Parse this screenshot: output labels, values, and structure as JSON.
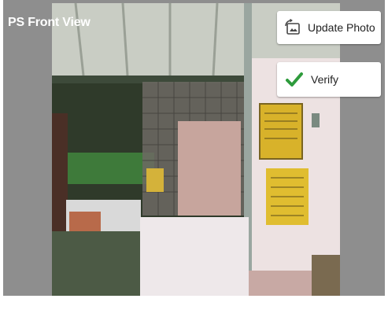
{
  "header": {
    "title": "PS Front View"
  },
  "actions": {
    "update_photo_label": "Update Photo",
    "verify_label": "Verify"
  },
  "icons": {
    "update": "photo-update-icon",
    "verify": "check-icon"
  },
  "colors": {
    "panel_gray": "#8e8e8e",
    "check_green": "#2e9b3c"
  }
}
